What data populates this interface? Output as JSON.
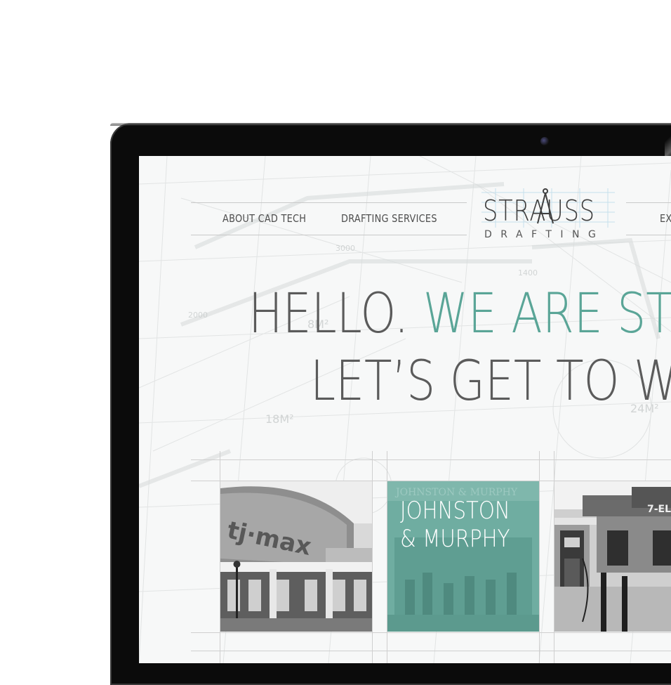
{
  "nav": {
    "left_items": [
      "ABOUT CAD TECH",
      "DRAFTING SERVICES"
    ],
    "right_item_partial": "EX"
  },
  "logo": {
    "word": "STRAUSS",
    "sub": "DRAFTING"
  },
  "hero": {
    "line1_dark": "HELLO.",
    "line1_accent": "WE ARE ST",
    "line2": "LET’S GET TO W"
  },
  "tiles": [
    {
      "name": "tj-maxx",
      "label": "",
      "image": "tj-maxx-store-photo"
    },
    {
      "name": "johnston-murphy",
      "label": "JOHNSTON\n& MURPHY",
      "image": "johnston-murphy-store-photo"
    },
    {
      "name": "seven-eleven",
      "label": "",
      "image": "seven-eleven-gas-station-photo"
    }
  ],
  "colors": {
    "accent": "#5aa597",
    "text": "#5b5b5b",
    "bezel": "#0b0b0b"
  }
}
